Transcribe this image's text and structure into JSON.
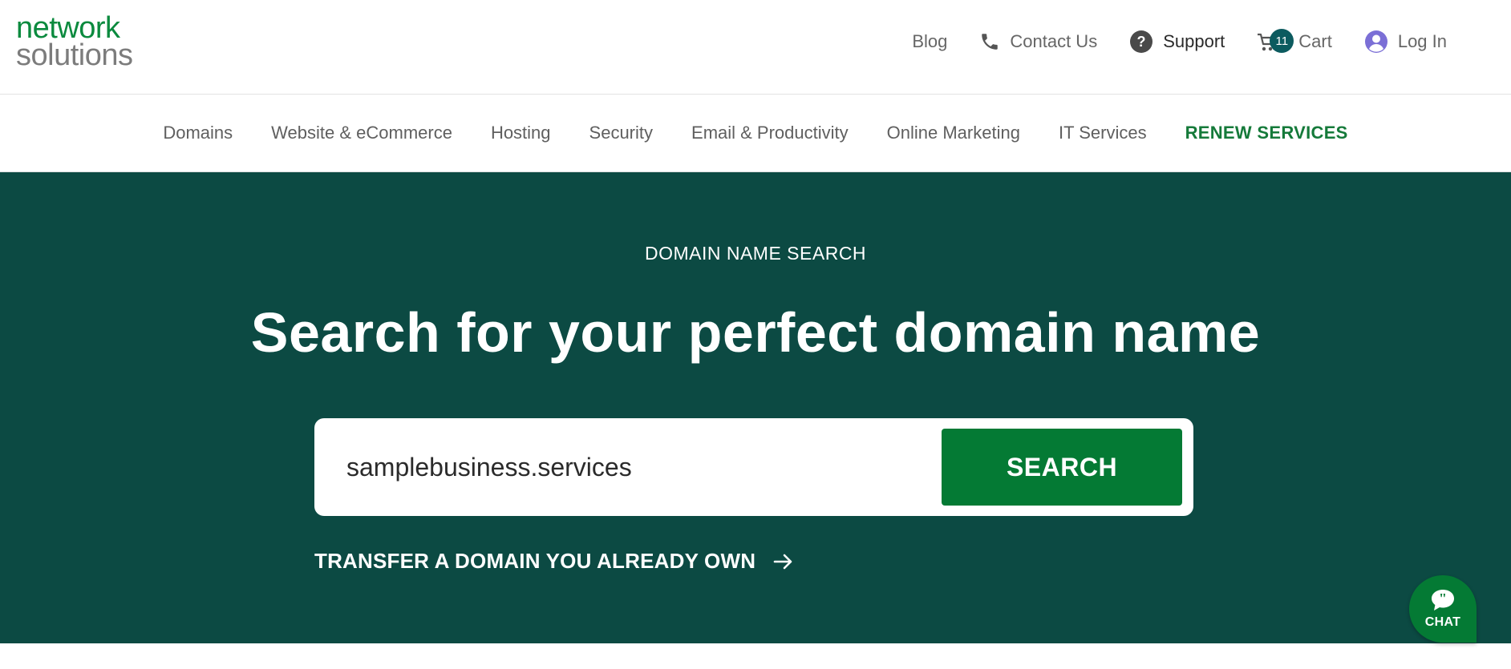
{
  "logo": {
    "line1": "network",
    "line2": "solutions"
  },
  "util_nav": {
    "blog": "Blog",
    "contact": "Contact Us",
    "support": "Support",
    "cart": {
      "label": "Cart",
      "count": "11"
    },
    "login": "Log In"
  },
  "main_nav": {
    "items": [
      {
        "label": "Domains"
      },
      {
        "label": "Website & eCommerce"
      },
      {
        "label": "Hosting"
      },
      {
        "label": "Security"
      },
      {
        "label": "Email & Productivity"
      },
      {
        "label": "Online Marketing"
      },
      {
        "label": "IT Services"
      },
      {
        "label": "RENEW SERVICES"
      }
    ]
  },
  "hero": {
    "eyebrow": "DOMAIN NAME SEARCH",
    "title": "Search for your perfect domain name",
    "search": {
      "value": "samplebusiness.services",
      "button": "SEARCH"
    },
    "transfer_link": "TRANSFER A DOMAIN YOU ALREADY OWN"
  },
  "chat": {
    "label": "CHAT"
  },
  "colors": {
    "brand_green": "#047a34",
    "hero_bg": "#0c4a43",
    "badge": "#0c5b5f",
    "user_icon": "#7b6fd6"
  },
  "icons": [
    "phone-icon",
    "help-icon",
    "cart-icon",
    "user-icon",
    "arrow-right-icon",
    "chat-icon"
  ]
}
